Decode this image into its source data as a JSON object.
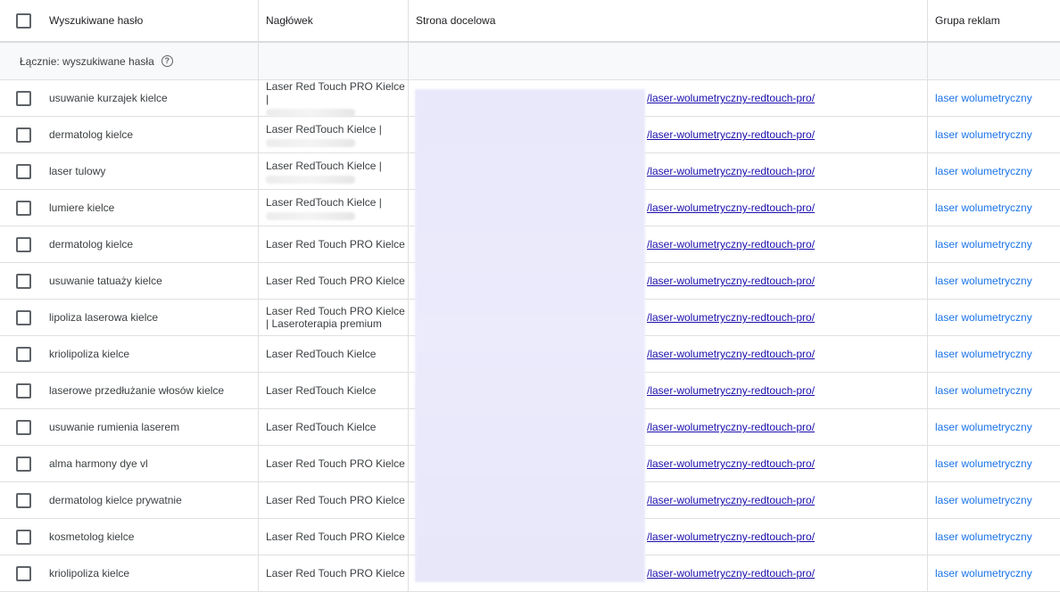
{
  "header": {
    "col_keyword": "Wyszukiwane hasło",
    "col_headline": "Nagłówek",
    "col_landing": "Strona docelowa",
    "col_adgroup": "Grupa reklam"
  },
  "total": {
    "label": "Łącznie: wyszukiwane hasła",
    "help_icon": "help-circle-icon"
  },
  "rows": [
    {
      "keyword": "usuwanie kurzajek kielce",
      "headline": "Laser Red Touch PRO Kielce",
      "headline2": "|",
      "url": "/laser-wolumetryczny-redtouch-pro/",
      "adgroup": "laser wolumetryczny"
    },
    {
      "keyword": "dermatolog kielce",
      "headline": "Laser RedTouch Kielce |",
      "headline2": "",
      "url": "/laser-wolumetryczny-redtouch-pro/",
      "adgroup": "laser wolumetryczny"
    },
    {
      "keyword": "laser tulowy",
      "headline": "Laser RedTouch Kielce |",
      "headline2": "",
      "url": "/laser-wolumetryczny-redtouch-pro/",
      "adgroup": "laser wolumetryczny"
    },
    {
      "keyword": "lumiere kielce",
      "headline": "Laser RedTouch Kielce |",
      "headline2": "",
      "url": "/laser-wolumetryczny-redtouch-pro/",
      "adgroup": "laser wolumetryczny"
    },
    {
      "keyword": "dermatolog kielce",
      "headline": "Laser Red Touch PRO Kielce",
      "headline2": "",
      "url": "/laser-wolumetryczny-redtouch-pro/",
      "adgroup": "laser wolumetryczny"
    },
    {
      "keyword": "usuwanie tatuaży kielce",
      "headline": "Laser Red Touch PRO Kielce",
      "headline2": "",
      "url": "/laser-wolumetryczny-redtouch-pro/",
      "adgroup": "laser wolumetryczny"
    },
    {
      "keyword": "lipoliza laserowa kielce",
      "headline": "Laser Red Touch PRO Kielce",
      "headline2": "| Laseroterapia premium",
      "url": "/laser-wolumetryczny-redtouch-pro/",
      "adgroup": "laser wolumetryczny"
    },
    {
      "keyword": "kriolipoliza kielce",
      "headline": "Laser RedTouch Kielce",
      "headline2": "",
      "url": "/laser-wolumetryczny-redtouch-pro/",
      "adgroup": "laser wolumetryczny"
    },
    {
      "keyword": "laserowe przedłużanie włosów kielce",
      "headline": "Laser RedTouch Kielce",
      "headline2": "",
      "url": "/laser-wolumetryczny-redtouch-pro/",
      "adgroup": "laser wolumetryczny"
    },
    {
      "keyword": "usuwanie rumienia laserem",
      "headline": "Laser RedTouch Kielce",
      "headline2": "",
      "url": "/laser-wolumetryczny-redtouch-pro/",
      "adgroup": "laser wolumetryczny"
    },
    {
      "keyword": "alma harmony dye vl",
      "headline": "Laser Red Touch PRO Kielce",
      "headline2": "",
      "url": "/laser-wolumetryczny-redtouch-pro/",
      "adgroup": "laser wolumetryczny"
    },
    {
      "keyword": "dermatolog kielce prywatnie",
      "headline": "Laser Red Touch PRO Kielce",
      "headline2": "",
      "url": "/laser-wolumetryczny-redtouch-pro/",
      "adgroup": "laser wolumetryczny"
    },
    {
      "keyword": "kosmetolog kielce",
      "headline": "Laser Red Touch PRO Kielce",
      "headline2": "",
      "url": "/laser-wolumetryczny-redtouch-pro/",
      "adgroup": "laser wolumetryczny"
    },
    {
      "keyword": "kriolipoliza kielce",
      "headline": "Laser Red Touch PRO Kielce",
      "headline2": "",
      "url": "/laser-wolumetryczny-redtouch-pro/",
      "adgroup": "laser wolumetryczny"
    }
  ],
  "colors": {
    "link": "#1a0dab",
    "group_link": "#1a73e8",
    "redaction": "#e9e8fb"
  }
}
